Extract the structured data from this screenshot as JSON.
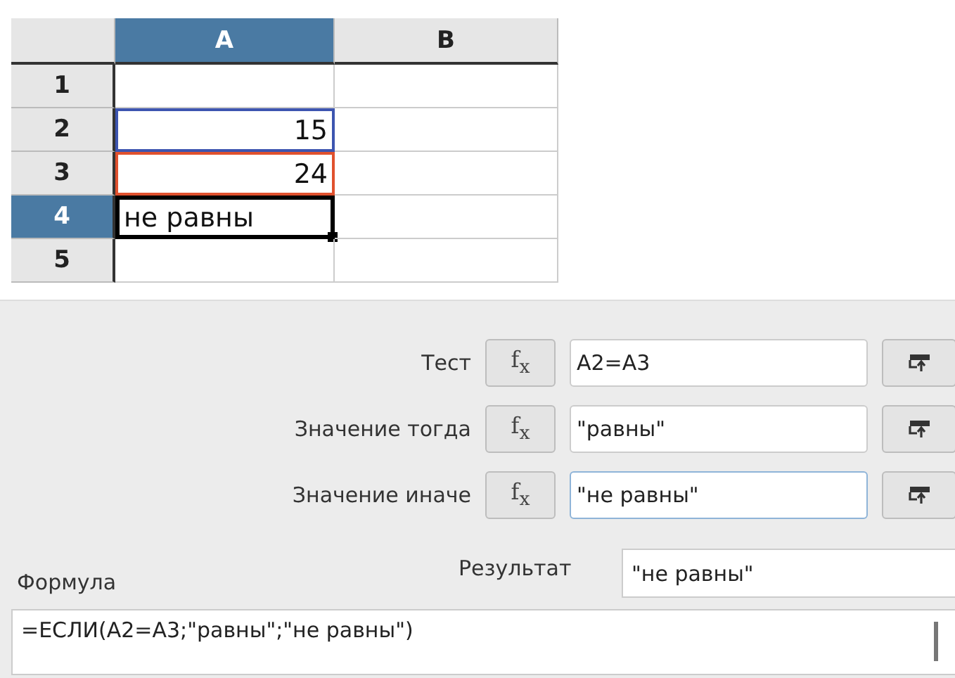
{
  "sheet": {
    "columns": [
      {
        "label": "A",
        "selected": true
      },
      {
        "label": "B",
        "selected": false
      }
    ],
    "rows": [
      {
        "label": "1",
        "selected": false,
        "cells": [
          {},
          {}
        ]
      },
      {
        "label": "2",
        "selected": false,
        "cells": [
          {
            "value": "15",
            "kind": "number",
            "color": "#3d55b0"
          },
          {}
        ]
      },
      {
        "label": "3",
        "selected": false,
        "cells": [
          {
            "value": "24",
            "kind": "number",
            "color": "#e0512e"
          },
          {}
        ]
      },
      {
        "label": "4",
        "selected": true,
        "cells": [
          {
            "value": "не равны",
            "kind": "text",
            "cursor": true
          },
          {}
        ]
      },
      {
        "label": "5",
        "selected": false,
        "cells": [
          {},
          {}
        ]
      }
    ]
  },
  "arguments": [
    {
      "label": "Тест",
      "fx": "f$_{x}$",
      "value": "A2=A3",
      "focused": false
    },
    {
      "label": "Значение тогда",
      "fx": "f$_{x}$",
      "value": "\"равны\"",
      "focused": false
    },
    {
      "label": "Значение иначе",
      "fx": "f$_{x}$",
      "value": "\"не равны\"",
      "focused": true
    }
  ],
  "result": {
    "label": "Результат",
    "value": "\"не равны\""
  },
  "formula": {
    "label": "Формула",
    "value": "=ЕСЛИ(A2=A3;\"равны\";\"не равны\")"
  }
}
